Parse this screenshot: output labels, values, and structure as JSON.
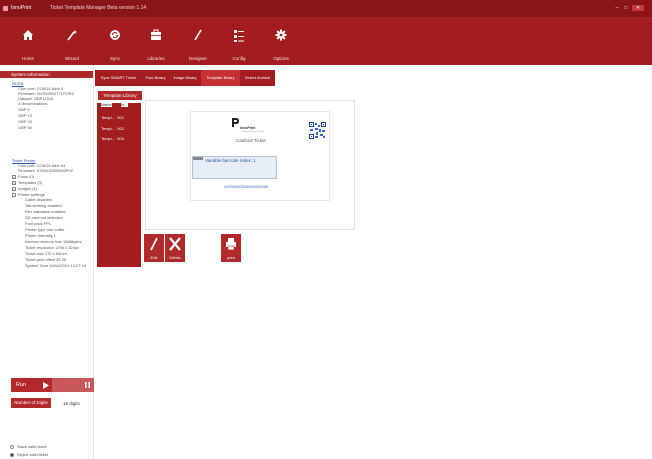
{
  "window": {
    "app_name": "InnoPrint",
    "title": "Ticket Template Manager Beta version 1.14"
  },
  "toolbar": [
    {
      "label": "Home",
      "icon": "home-icon"
    },
    {
      "label": "Wizard",
      "icon": "wand-icon"
    },
    {
      "label": "Sync",
      "icon": "sync-icon"
    },
    {
      "label": "Libraries",
      "icon": "briefcase-icon"
    },
    {
      "label": "Designer",
      "icon": "pen-icon"
    },
    {
      "label": "Config",
      "icon": "config-icon"
    },
    {
      "label": "Options",
      "icon": "gear-icon"
    }
  ],
  "sidebar": {
    "system_header": "System Information",
    "ncds_title": "NCDS",
    "ncds_lines": [
      "Com port: COM14 Addr 0",
      "Firmware: NVS09002771POR2",
      "Dataset: GBP11515",
      "4 denominations",
      "GBP 5",
      "GBP 10",
      "GBP 20",
      "GBP 50"
    ],
    "printer_title": "Ticket Printer",
    "printer_lines": [
      "Com port: COM15 Addr 64",
      "Firmware: 5750010000000P02"
    ],
    "tree": [
      "Fonts (0)",
      "Templates (3)",
      "Images (1)",
      "Printer settings"
    ],
    "settings": [
      "Cutter disabled",
      "Tab sensing enabled",
      "Rev validation enabled",
      "SD card not detected",
      "Font pack FP1",
      "Printer type non cutter",
      "Printer intensity 1",
      "Internal memory free 1556bytes",
      "Ticket resolution 1296 x 324px",
      "Ticket size 170 x 65mm",
      "Ticket peel offset 30.25",
      "System Time 24/04/2014 13:27:19"
    ],
    "run_label": "Run",
    "digits_button": "Number of Digits",
    "digits_value": "18 digits",
    "radio_stack": "Stack valid ticket",
    "radio_reject": "Reject valid ticket"
  },
  "tabs": [
    "Sync SMART Ticket",
    "Font library",
    "Image library",
    "Template library",
    "Select Archive"
  ],
  "active_tab": "Template library",
  "library": {
    "button": "Template Library",
    "col_name": "Name",
    "col_in": "In...",
    "rows": [
      {
        "name": "Templ...",
        "index": "001"
      },
      {
        "name": "Templ...",
        "index": "002"
      },
      {
        "name": "Templ...",
        "index": "003"
      }
    ]
  },
  "ticket": {
    "brand": "InnoPrint",
    "brand_sub": "Intelligent Ticket Printing",
    "title": "Cashout Ticket",
    "barcode_label": "Variable barcode index: 1",
    "barcode_value": "x2000000000000000000"
  },
  "actions": [
    {
      "label": "Edit",
      "icon": "pen-icon"
    },
    {
      "label": "Delete",
      "icon": "close-icon"
    },
    {
      "label": "print",
      "icon": "printer-icon"
    }
  ],
  "colors": {
    "brand_red": "#a31c1f",
    "title_bar": "#8a1518",
    "link_blue": "#2a55a0"
  }
}
